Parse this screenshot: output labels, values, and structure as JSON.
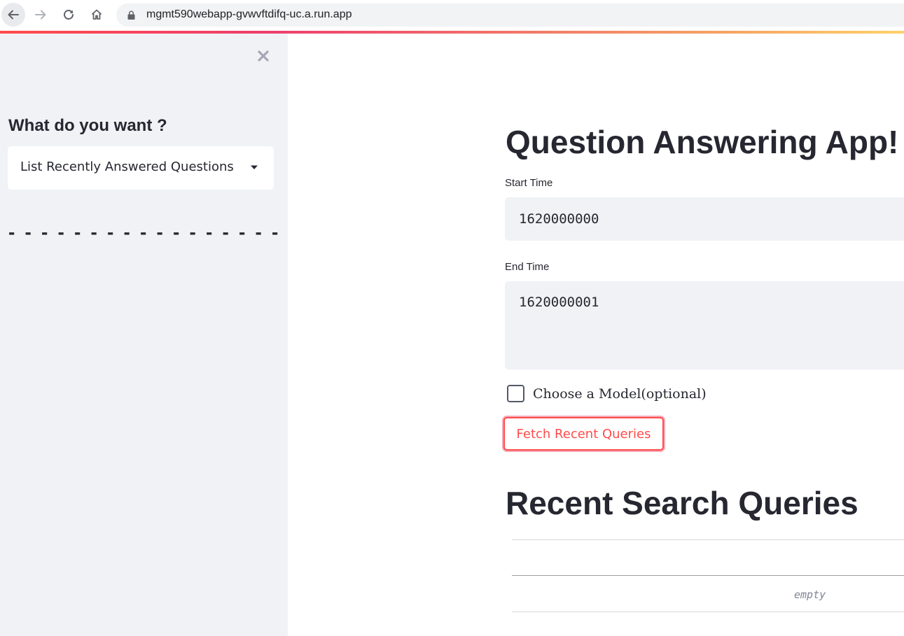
{
  "browser": {
    "url": "mgmt590webapp-gvwvftdifq-uc.a.run.app",
    "nav_icons": [
      "back-arrow-icon",
      "forward-arrow-icon",
      "reload-icon",
      "home-icon",
      "lock-icon"
    ]
  },
  "sidebar": {
    "close_icon": "close-icon",
    "label": "What do you want ?",
    "select": {
      "value": "List Recently Answered Questions",
      "caret_icon": "caret-down-icon"
    },
    "divider": "- - - - - - - - - - - - - - - - - -"
  },
  "main": {
    "title": "Question Answering App!",
    "start_time": {
      "label": "Start Time",
      "value": "1620000000"
    },
    "end_time": {
      "label": "End Time",
      "value": "1620000001"
    },
    "model_checkbox": {
      "label": "Choose a Model(optional)",
      "checked": false
    },
    "fetch_button": "Fetch Recent Queries",
    "section_title": "Recent Search Queries",
    "table": {
      "empty_text": "empty"
    }
  },
  "colors": {
    "primary": "#ff4b4b",
    "sidebar_bg": "#f0f2f6",
    "text": "#262730"
  }
}
